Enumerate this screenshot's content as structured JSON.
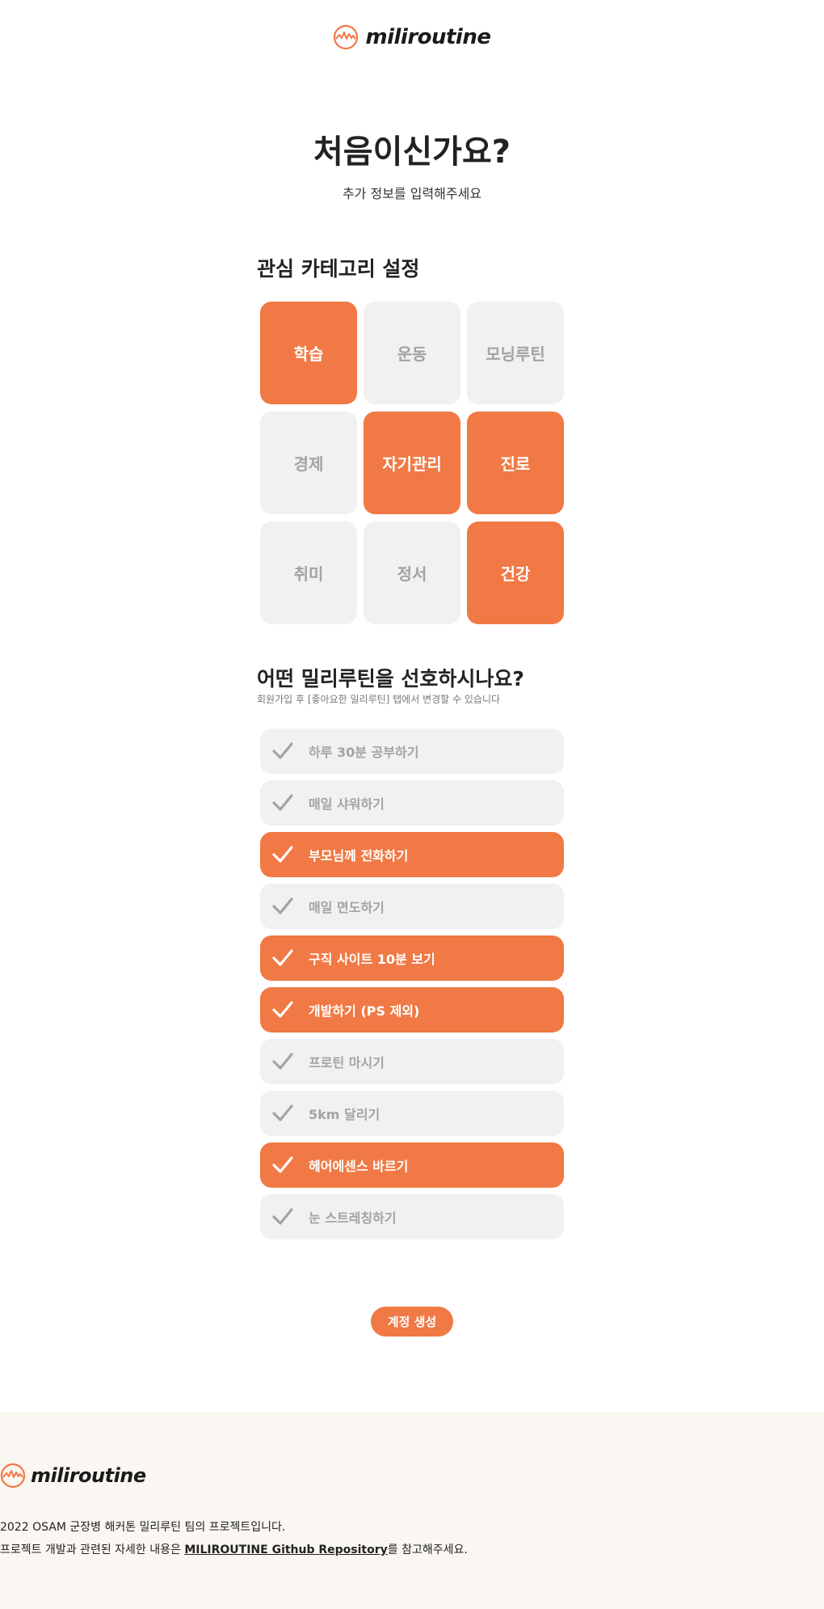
{
  "header": {
    "logo_text": "miliroutine"
  },
  "intro": {
    "title": "처음이신가요?",
    "subtitle": "추가 정보를 입력해주세요"
  },
  "categories": {
    "title": "관심 카테고리 설정",
    "items": [
      {
        "label": "학습",
        "selected": true
      },
      {
        "label": "운동",
        "selected": false
      },
      {
        "label": "모닝루틴",
        "selected": false
      },
      {
        "label": "경제",
        "selected": false
      },
      {
        "label": "자기관리",
        "selected": true
      },
      {
        "label": "진로",
        "selected": true
      },
      {
        "label": "취미",
        "selected": false
      },
      {
        "label": "정서",
        "selected": false
      },
      {
        "label": "건강",
        "selected": true
      }
    ]
  },
  "routines": {
    "title": "어떤 밀리루틴을 선호하시나요?",
    "subtitle": "회원가입 후 [좋아요한 밀리루틴] 탭에서 변경할 수 있습니다",
    "icon": "check-icon",
    "items": [
      {
        "label": "하루 30분 공부하기",
        "selected": false
      },
      {
        "label": "매일 샤워하기",
        "selected": false
      },
      {
        "label": "부모님께 전화하기",
        "selected": true
      },
      {
        "label": "매일 면도하기",
        "selected": false
      },
      {
        "label": "구직 사이트 10분 보기",
        "selected": true
      },
      {
        "label": "개발하기 (PS 제외)",
        "selected": true
      },
      {
        "label": "프로틴 마시기",
        "selected": false
      },
      {
        "label": "5km 달리기",
        "selected": false
      },
      {
        "label": "헤어에센스 바르기",
        "selected": true
      },
      {
        "label": "눈 스트레칭하기",
        "selected": false
      }
    ]
  },
  "actions": {
    "create_account": "계정 생성"
  },
  "footer": {
    "logo_text": "miliroutine",
    "line1": "2022 OSAM 군장병 해커톤 밀리루틴 팀의 프로젝트입니다.",
    "line2_prefix": "프로젝트 개발과 관련된 자세한 내용은 ",
    "line2_link": "MILIROUTINE Github Repository",
    "line2_suffix": "를 참고해주세요."
  },
  "colors": {
    "accent": "#f07945",
    "inactive_bg": "#f1f1f1",
    "inactive_text": "#a3a3a3",
    "footer_bg": "#faf6f1"
  }
}
